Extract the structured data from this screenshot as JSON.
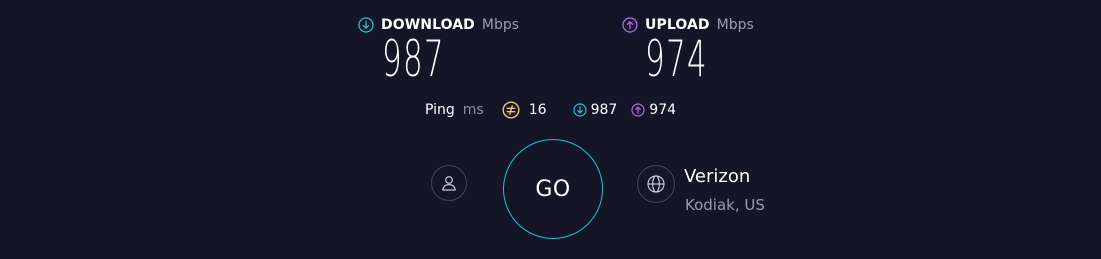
{
  "download": {
    "label": "DOWNLOAD",
    "unit": "Mbps",
    "value": "987"
  },
  "upload": {
    "label": "UPLOAD",
    "unit": "Mbps",
    "value": "974"
  },
  "ping": {
    "label": "Ping",
    "unit": "ms",
    "value": "16",
    "mini_download": "987",
    "mini_upload": "974"
  },
  "controls": {
    "go_label": "GO"
  },
  "server": {
    "provider": "Verizon",
    "location": "Kodiak, US"
  },
  "colors": {
    "background": "#141526",
    "download_accent": "#23c0d6",
    "upload_accent": "#b36ae6",
    "ping_accent": "#f2c96a",
    "muted_text": "#9a9cb3"
  },
  "icons": {
    "download": "arrow-down-circle-icon",
    "upload": "arrow-up-circle-icon",
    "ping": "ping-gauge-icon",
    "profile": "user-icon",
    "server": "globe-icon"
  }
}
